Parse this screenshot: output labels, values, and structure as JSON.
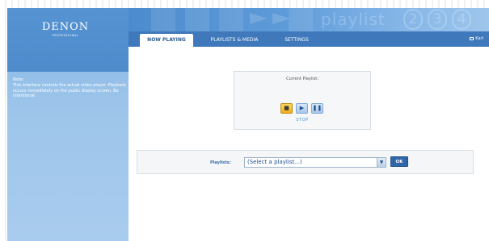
{
  "brand": {
    "name": "DENON",
    "subtitle": "PROFESSIONAL"
  },
  "header": {
    "decor_word": "playlist",
    "decor_numbers": [
      "2",
      "3",
      "4"
    ]
  },
  "nav": {
    "tabs": [
      {
        "label": "NOW PLAYING",
        "active": true
      },
      {
        "label": "PLAYLISTS & MEDIA",
        "active": false
      },
      {
        "label": "SETTINGS",
        "active": false
      }
    ],
    "user_label": "Karl",
    "user_icon": "user-icon"
  },
  "sidebar": {
    "note_title": "Note:",
    "note_text": "This interface controls the actual video player. Playback occurs immediately on the public display screen. Be intentional."
  },
  "player": {
    "title": "Current Playlist:",
    "controls": [
      {
        "icon": "stop-icon",
        "glyph": "■",
        "active": true
      },
      {
        "icon": "play-icon",
        "glyph": "▶",
        "active": false
      },
      {
        "icon": "pause-icon",
        "glyph": "❚❚",
        "active": false
      }
    ],
    "status": "STOP"
  },
  "playlist": {
    "label": "Playlists:",
    "selected": "(Select a playlist...)",
    "ok_label": "OK"
  },
  "colors": {
    "accent": "#4c8bcd",
    "nav": "#3f78bb",
    "active_control": "#f2ad16"
  }
}
